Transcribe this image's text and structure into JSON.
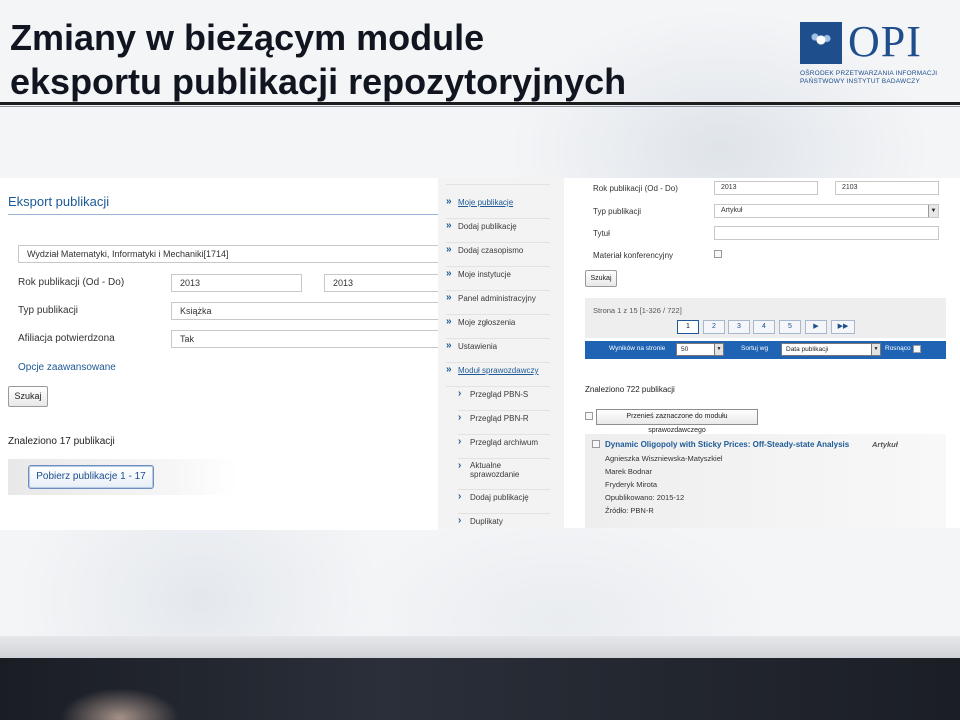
{
  "slide": {
    "title_line1": "Zmiany w bieżącym module",
    "title_line2": "eksportu publikacji repozytoryjnych",
    "logo_text": "OPI",
    "logo_sub1": "OŚRODEK PRZETWARZANIA INFORMACJI",
    "logo_sub2": "PAŃSTWOWY INSTYTUT BADAWCZY",
    "colors": {
      "accent": "#1d5a96",
      "logo": "#1f4e8c",
      "sortbar": "#1f63b4"
    }
  },
  "left_panel": {
    "heading": "Eksport publikacji",
    "unit_value": "Wydział Matematyki, Informatyki i Mechaniki[1714]",
    "year_label": "Rok publikacji (Od - Do)",
    "year_from": "2013",
    "year_to": "2013",
    "type_label": "Typ publikacji",
    "type_value": "Książka",
    "affiliation_label": "Afiliacja potwierdzona",
    "affiliation_value": "Tak",
    "advanced_link": "Opcje zaawansowane",
    "search_button": "Szukaj",
    "found_text": "Znaleziono 17 publikacji",
    "download_button": "Pobierz publikacje 1 - 17"
  },
  "nav_menu": {
    "items": [
      {
        "label": "Moje publikacje",
        "active": true
      },
      {
        "label": "Dodaj publikację"
      },
      {
        "label": "Dodaj czasopismo"
      },
      {
        "label": "Moje instytucje"
      },
      {
        "label": "Panel administracyjny"
      },
      {
        "label": "Moje zgłoszenia"
      },
      {
        "label": "Ustawienia"
      },
      {
        "label": "Moduł sprawozdawczy",
        "active": true
      }
    ],
    "subitems": [
      {
        "label": "Przegląd PBN-S"
      },
      {
        "label": "Przegląd PBN-R"
      },
      {
        "label": "Przegląd archiwum"
      },
      {
        "label": "Aktualne sprawozdanie",
        "line1": "Aktualne",
        "line2": "sprawozdanie"
      },
      {
        "label": "Dodaj publikację"
      },
      {
        "label": "Duplikaty"
      }
    ]
  },
  "right_panel": {
    "year_label": "Rok publikacji (Od - Do)",
    "year_from": "2013",
    "year_to": "2103",
    "type_label": "Typ publikacji",
    "type_value": "Artykuł",
    "title_label": "Tytuł",
    "title_value": "",
    "conference_label": "Materiał konferencyjny",
    "search_button": "Szukaj",
    "pager_info": "Strona 1 z 15 [1-326 / 722]",
    "pages": [
      "1",
      "2",
      "3",
      "4",
      "5",
      "▶",
      "▶▶"
    ],
    "current_page": "1",
    "per_page_label": "Wyników na stronie",
    "per_page_value": "50",
    "sort_label": "Sortuj wg",
    "sort_value": "Data publikacji",
    "asc_label": "Rosnąco",
    "found_text": "Znaleziono 722 publikacji",
    "move_button": "Przenieś zaznaczone do modułu sprawozdawczego",
    "result": {
      "title": "Dynamic Oligopoly with Sticky Prices: Off-Steady-state Analysis",
      "type": "Artykuł",
      "authors": [
        "Agnieszka Wiszniewska-Matyszkiel",
        "Marek Bodnar",
        "Fryderyk Mirota"
      ],
      "published": "Opublikowano: 2015-12",
      "source": "Źródło: PBN-R"
    }
  }
}
